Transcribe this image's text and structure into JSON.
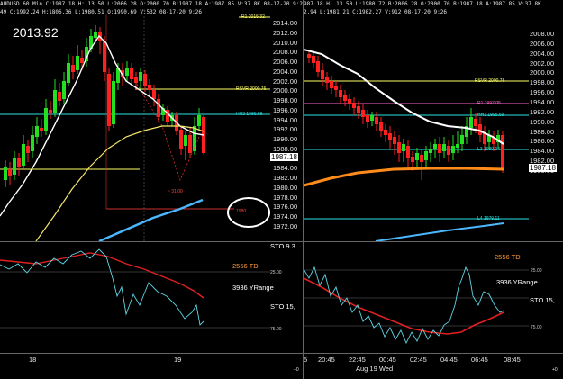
{
  "left": {
    "header": "AUDUSD 60 Min C:1987.18 H: 13.50 L:2006.28 O:2000.70 B:1987.18 A:1987.85 V:37.8K 08-17-20 9:26",
    "header_b": "49 C:1992.24 H:1806.36 L:1980.51 O:1990.69 V:532 08-17-20 9:26",
    "big_price": "2013.92",
    "y_ticks": [
      "2014.00",
      "2012.00",
      "2010.00",
      "2008.00",
      "2006.00",
      "2004.00",
      "2002.00",
      "2000.00",
      "1998.00",
      "1996.00",
      "1994.00",
      "1992.00",
      "1990.00",
      "1988.00",
      "1986.00",
      "1984.00",
      "1982.00",
      "1980.00",
      "1978.00",
      "1976.00",
      "1974.00",
      "1972.00"
    ],
    "price_tag": "1987.18",
    "levels": {
      "r1": "R1 2015.32",
      "rsvr": "RSVR 2000.76",
      "hh3": "HH3 1995.59",
      "l1": "1980",
      "l4": "L4 1979.11",
      "low": "~ 31.00"
    },
    "sto": {
      "label_top": "STO 9.3",
      "td": "2556 TD",
      "yrange": "3936 YRange",
      "label_mid": "STO 15,",
      "t_25": "25.00",
      "t_75": "75.00"
    },
    "x_ticks": [
      "18",
      "19"
    ],
    "corner": "+0"
  },
  "right": {
    "header": "987.18 H: 13.50 L:1980.72 B:2006.28 O:2000.70 B:1987.18 A:1987.85 V:37.8K",
    "header_b": "2.94 L:1981.21 C:1982.27 V:912 08-17-20 9:26",
    "y_ticks": [
      "2008.00",
      "2006.00",
      "2004.00",
      "2002.00",
      "2000.00",
      "1998.00",
      "1996.00",
      "1994.00",
      "1992.00",
      "1990.00",
      "1988.00",
      "1986.00",
      "1984.00",
      "1982.00",
      "1980.00"
    ],
    "price_tag": "1987.18",
    "levels": {
      "rsvr": "RSVR 2000.76",
      "rr": "R1 1997.05",
      "hh3": "HH3 1995.59",
      "l3": "L3 1989.94",
      "l4": "L4 1979.11"
    },
    "sto": {
      "td": "2556 TD",
      "yrange": "3936 YRange",
      "label_mid": "STO 15,",
      "t_25": "25.00",
      "t_75": "75.00"
    },
    "x_ticks": [
      "5",
      "20:45",
      "22:45",
      "00:45",
      "02:45",
      "04:45",
      "06:45",
      "08:45"
    ],
    "date_label": "Aug 19 Wed",
    "corner": "+0"
  },
  "colors": {
    "up": "#22e020",
    "down": "#ff2020",
    "white_ma": "#ffffff",
    "yellow_ma": "#f5e66a",
    "blue_ma": "#4bb7ff",
    "orange_ma": "#ff8c1a",
    "level_yellow": "#ffff66",
    "level_cyan": "#29e3e3",
    "level_pink": "#ff66cc",
    "sto_red": "#e02020",
    "sto_cyan": "#5fd6e6"
  }
}
